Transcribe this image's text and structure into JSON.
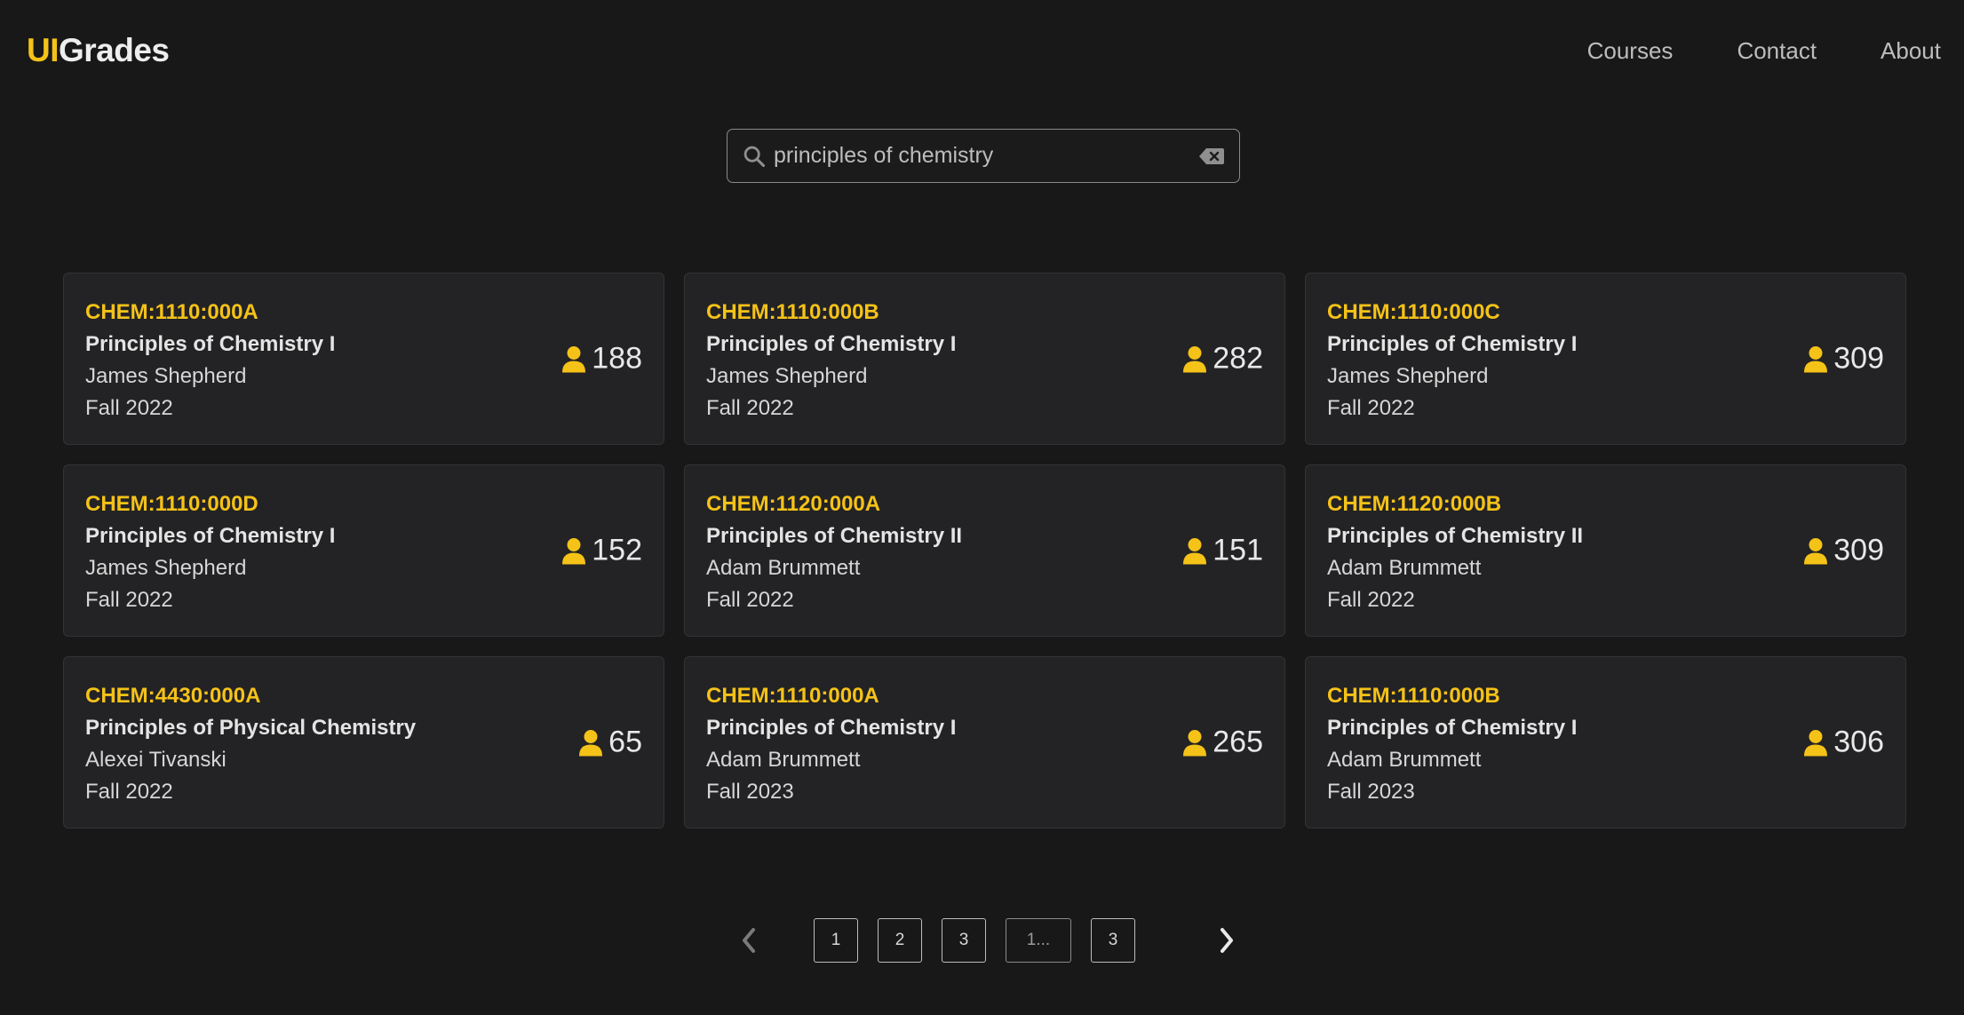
{
  "header": {
    "logo_part1": "UI",
    "logo_part2": "Grades",
    "nav": [
      "Courses",
      "Contact",
      "About"
    ]
  },
  "search": {
    "value": "principles of chemistry"
  },
  "courses": [
    {
      "code": "CHEM:1110:000A",
      "title": "Principles of Chemistry I",
      "instructor": "James Shepherd",
      "term": "Fall 2022",
      "students": "188"
    },
    {
      "code": "CHEM:1110:000B",
      "title": "Principles of Chemistry I",
      "instructor": "James Shepherd",
      "term": "Fall 2022",
      "students": "282"
    },
    {
      "code": "CHEM:1110:000C",
      "title": "Principles of Chemistry I",
      "instructor": "James Shepherd",
      "term": "Fall 2022",
      "students": "309"
    },
    {
      "code": "CHEM:1110:000D",
      "title": "Principles of Chemistry I",
      "instructor": "James Shepherd",
      "term": "Fall 2022",
      "students": "152"
    },
    {
      "code": "CHEM:1120:000A",
      "title": "Principles of Chemistry II",
      "instructor": "Adam Brummett",
      "term": "Fall 2022",
      "students": "151"
    },
    {
      "code": "CHEM:1120:000B",
      "title": "Principles of Chemistry II",
      "instructor": "Adam Brummett",
      "term": "Fall 2022",
      "students": "309"
    },
    {
      "code": "CHEM:4430:000A",
      "title": "Principles of Physical Chemistry",
      "instructor": "Alexei Tivanski",
      "term": "Fall 2022",
      "students": "65"
    },
    {
      "code": "CHEM:1110:000A",
      "title": "Principles of Chemistry I",
      "instructor": "Adam Brummett",
      "term": "Fall 2023",
      "students": "265"
    },
    {
      "code": "CHEM:1110:000B",
      "title": "Principles of Chemistry I",
      "instructor": "Adam Brummett",
      "term": "Fall 2023",
      "students": "306"
    }
  ],
  "pagination": {
    "pages": [
      "1",
      "2",
      "3",
      "1...",
      "3"
    ],
    "prev_icon": "chevron-left-icon",
    "next_icon": "chevron-right-icon"
  },
  "colors": {
    "accent": "#f5c218",
    "background": "#181818",
    "card": "#232325"
  }
}
